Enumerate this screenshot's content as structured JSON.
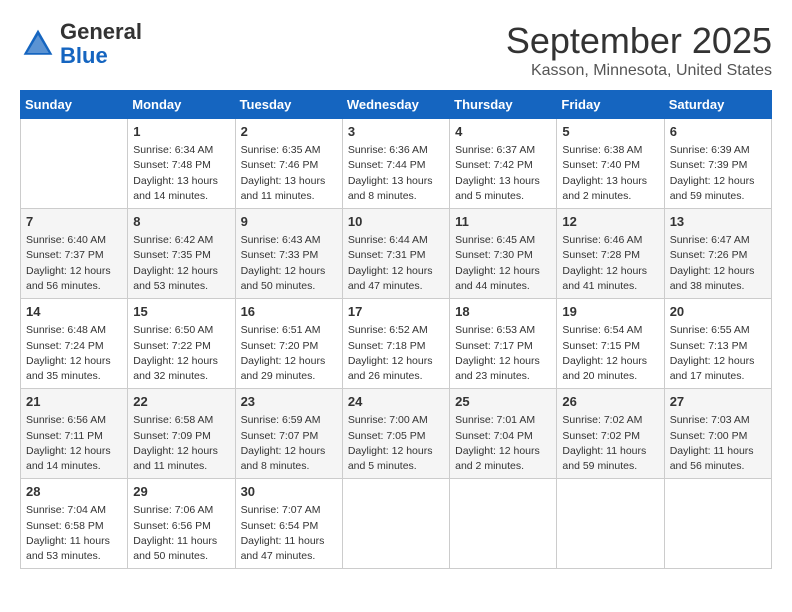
{
  "header": {
    "logo_line1": "General",
    "logo_line2": "Blue",
    "month": "September 2025",
    "location": "Kasson, Minnesota, United States"
  },
  "days_of_week": [
    "Sunday",
    "Monday",
    "Tuesday",
    "Wednesday",
    "Thursday",
    "Friday",
    "Saturday"
  ],
  "weeks": [
    [
      {
        "day": "",
        "content": ""
      },
      {
        "day": "1",
        "content": "Sunrise: 6:34 AM\nSunset: 7:48 PM\nDaylight: 13 hours\nand 14 minutes."
      },
      {
        "day": "2",
        "content": "Sunrise: 6:35 AM\nSunset: 7:46 PM\nDaylight: 13 hours\nand 11 minutes."
      },
      {
        "day": "3",
        "content": "Sunrise: 6:36 AM\nSunset: 7:44 PM\nDaylight: 13 hours\nand 8 minutes."
      },
      {
        "day": "4",
        "content": "Sunrise: 6:37 AM\nSunset: 7:42 PM\nDaylight: 13 hours\nand 5 minutes."
      },
      {
        "day": "5",
        "content": "Sunrise: 6:38 AM\nSunset: 7:40 PM\nDaylight: 13 hours\nand 2 minutes."
      },
      {
        "day": "6",
        "content": "Sunrise: 6:39 AM\nSunset: 7:39 PM\nDaylight: 12 hours\nand 59 minutes."
      }
    ],
    [
      {
        "day": "7",
        "content": "Sunrise: 6:40 AM\nSunset: 7:37 PM\nDaylight: 12 hours\nand 56 minutes."
      },
      {
        "day": "8",
        "content": "Sunrise: 6:42 AM\nSunset: 7:35 PM\nDaylight: 12 hours\nand 53 minutes."
      },
      {
        "day": "9",
        "content": "Sunrise: 6:43 AM\nSunset: 7:33 PM\nDaylight: 12 hours\nand 50 minutes."
      },
      {
        "day": "10",
        "content": "Sunrise: 6:44 AM\nSunset: 7:31 PM\nDaylight: 12 hours\nand 47 minutes."
      },
      {
        "day": "11",
        "content": "Sunrise: 6:45 AM\nSunset: 7:30 PM\nDaylight: 12 hours\nand 44 minutes."
      },
      {
        "day": "12",
        "content": "Sunrise: 6:46 AM\nSunset: 7:28 PM\nDaylight: 12 hours\nand 41 minutes."
      },
      {
        "day": "13",
        "content": "Sunrise: 6:47 AM\nSunset: 7:26 PM\nDaylight: 12 hours\nand 38 minutes."
      }
    ],
    [
      {
        "day": "14",
        "content": "Sunrise: 6:48 AM\nSunset: 7:24 PM\nDaylight: 12 hours\nand 35 minutes."
      },
      {
        "day": "15",
        "content": "Sunrise: 6:50 AM\nSunset: 7:22 PM\nDaylight: 12 hours\nand 32 minutes."
      },
      {
        "day": "16",
        "content": "Sunrise: 6:51 AM\nSunset: 7:20 PM\nDaylight: 12 hours\nand 29 minutes."
      },
      {
        "day": "17",
        "content": "Sunrise: 6:52 AM\nSunset: 7:18 PM\nDaylight: 12 hours\nand 26 minutes."
      },
      {
        "day": "18",
        "content": "Sunrise: 6:53 AM\nSunset: 7:17 PM\nDaylight: 12 hours\nand 23 minutes."
      },
      {
        "day": "19",
        "content": "Sunrise: 6:54 AM\nSunset: 7:15 PM\nDaylight: 12 hours\nand 20 minutes."
      },
      {
        "day": "20",
        "content": "Sunrise: 6:55 AM\nSunset: 7:13 PM\nDaylight: 12 hours\nand 17 minutes."
      }
    ],
    [
      {
        "day": "21",
        "content": "Sunrise: 6:56 AM\nSunset: 7:11 PM\nDaylight: 12 hours\nand 14 minutes."
      },
      {
        "day": "22",
        "content": "Sunrise: 6:58 AM\nSunset: 7:09 PM\nDaylight: 12 hours\nand 11 minutes."
      },
      {
        "day": "23",
        "content": "Sunrise: 6:59 AM\nSunset: 7:07 PM\nDaylight: 12 hours\nand 8 minutes."
      },
      {
        "day": "24",
        "content": "Sunrise: 7:00 AM\nSunset: 7:05 PM\nDaylight: 12 hours\nand 5 minutes."
      },
      {
        "day": "25",
        "content": "Sunrise: 7:01 AM\nSunset: 7:04 PM\nDaylight: 12 hours\nand 2 minutes."
      },
      {
        "day": "26",
        "content": "Sunrise: 7:02 AM\nSunset: 7:02 PM\nDaylight: 11 hours\nand 59 minutes."
      },
      {
        "day": "27",
        "content": "Sunrise: 7:03 AM\nSunset: 7:00 PM\nDaylight: 11 hours\nand 56 minutes."
      }
    ],
    [
      {
        "day": "28",
        "content": "Sunrise: 7:04 AM\nSunset: 6:58 PM\nDaylight: 11 hours\nand 53 minutes."
      },
      {
        "day": "29",
        "content": "Sunrise: 7:06 AM\nSunset: 6:56 PM\nDaylight: 11 hours\nand 50 minutes."
      },
      {
        "day": "30",
        "content": "Sunrise: 7:07 AM\nSunset: 6:54 PM\nDaylight: 11 hours\nand 47 minutes."
      },
      {
        "day": "",
        "content": ""
      },
      {
        "day": "",
        "content": ""
      },
      {
        "day": "",
        "content": ""
      },
      {
        "day": "",
        "content": ""
      }
    ]
  ]
}
